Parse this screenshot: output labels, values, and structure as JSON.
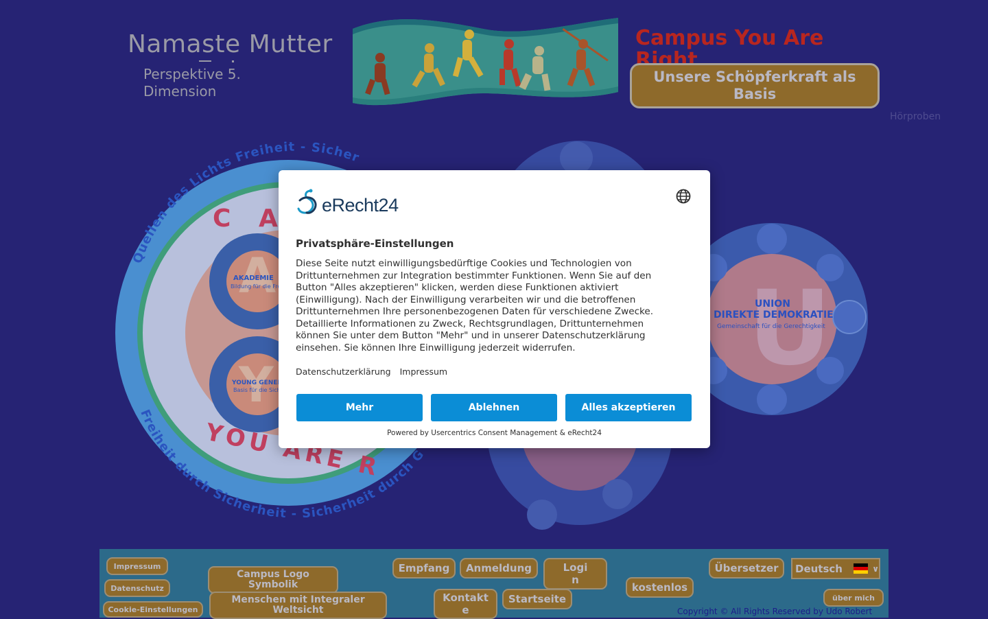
{
  "header": {
    "site_title": "Namaste Mutter",
    "site_subtitle": "Perspektive 5. Dimension",
    "campus_heading": "Campus You Are Right",
    "hero_button": "Unsere Schöpferkraft als Basis",
    "hoerproben": "Hörproben"
  },
  "logos": {
    "campus": {
      "ring_top": "Quellen des Lichts Freiheit - Sicher",
      "ring_bottom": "Freiheit durch Sicherheit - Sicherheit durch Gere",
      "campus_letters": "C A M",
      "you_are": "YOU ARE R",
      "akademie": "AKADEMIE",
      "akademie_sub": "Bildung für die Frei",
      "young": "YOUNG GENERAT",
      "young_sub": "Basis für die Sicher",
      "letter_a": "A",
      "letter_y": "Y"
    },
    "union": {
      "title1": "UNION",
      "title2": "DIREKTE DEMOKRATIE",
      "sub": "Gemeinschaft für die Gerechtigkeit",
      "letter": "U"
    }
  },
  "footer": {
    "impressum": "Impressum",
    "datenschutz": "Datenschutz",
    "cookie": "Cookie-Einstellungen",
    "campus_logo": "Campus Logo Symbolik",
    "menschen": "Menschen mit Integraler Weltsicht",
    "empfang": "Empfang",
    "anmeldung": "Anmeldung",
    "login": "Logi n",
    "kontakte": "Kontakt e",
    "startseite": "Startseite",
    "kostenlos": "kostenlos",
    "uebersetzer": "Übersetzer",
    "language": "Deutsch",
    "ueber_mich": "über mich",
    "copyright": "Copyright © All Rights Reserved by Udo Robert"
  },
  "consent": {
    "brand": "eRecht24",
    "title": "Privatsphäre-Einstellungen",
    "text": "Diese Seite nutzt einwilligungsbedürftige Cookies und Technologien von Drittunternehmen zur Integration bestimmter Funktionen. Wenn Sie auf den Button \"Alles akzeptieren\" klicken, werden diese Funktionen aktiviert (Einwilligung). Nach der Einwilligung verarbeiten wir und die betroffenen Drittunternehmen Ihre personenbezogenen Daten für verschiedene Zwecke. Detaillierte Informationen zu Zweck, Rechtsgrundlagen, Drittunternehmen können Sie unter dem Button \"Mehr\" und in unserer Datenschutzerklärung einsehen. Sie können Ihre Einwilligung jederzeit widerrufen.",
    "link_privacy": "Datenschutzerklärung",
    "link_imprint": "Impressum",
    "btn_more": "Mehr",
    "btn_deny": "Ablehnen",
    "btn_accept": "Alles akzeptieren",
    "powered": "Powered by Usercentrics Consent Management & eRecht24"
  },
  "colors": {
    "background": "#262374",
    "button": "#8e6a2b",
    "footer": "#2c6a8a",
    "consent_button": "#0b8dd6",
    "heading_red": "#b8261f"
  }
}
